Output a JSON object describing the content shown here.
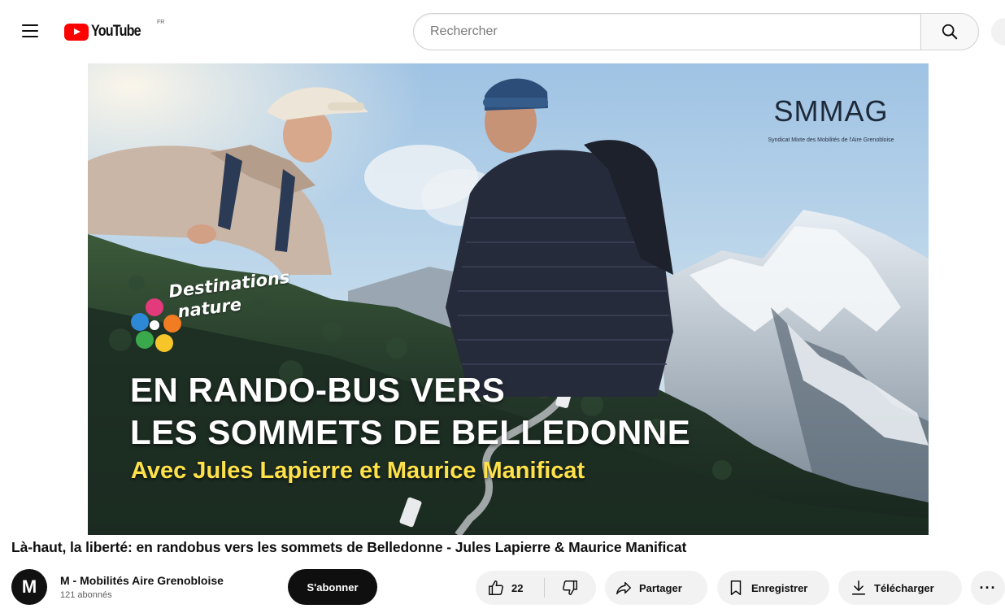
{
  "header": {
    "logo_text": "YouTube",
    "country_code": "FR",
    "search_placeholder": "Rechercher"
  },
  "thumbnail": {
    "brand_name": "SMMAG",
    "brand_subtitle": "Syndicat Mixte des Mobilités de l'Aire Grenobloise",
    "series_line1": "Destinations",
    "series_line2": "nature",
    "headline_line1": "EN RANDO-BUS VERS",
    "headline_line2": "LES SOMMETS DE BELLEDONNE",
    "subline": "Avec Jules Lapierre et Maurice Manificat"
  },
  "video": {
    "title": "Là-haut, la liberté: en randobus vers les sommets de Belledonne - Jules Lapierre & Maurice Manificat"
  },
  "channel": {
    "avatar_letter": "M",
    "name": "M - Mobilités Aire Grenobloise",
    "subscribers": "121 abonnés",
    "subscribe_label": "S'abonner"
  },
  "actions": {
    "like_count": "22",
    "share_label": "Partager",
    "save_label": "Enregistrer",
    "download_label": "Télécharger",
    "more_label": "···"
  },
  "colors": {
    "brand_red": "#ff0000",
    "subline_yellow": "#ffe14a",
    "pill_bg": "#f2f2f2"
  }
}
